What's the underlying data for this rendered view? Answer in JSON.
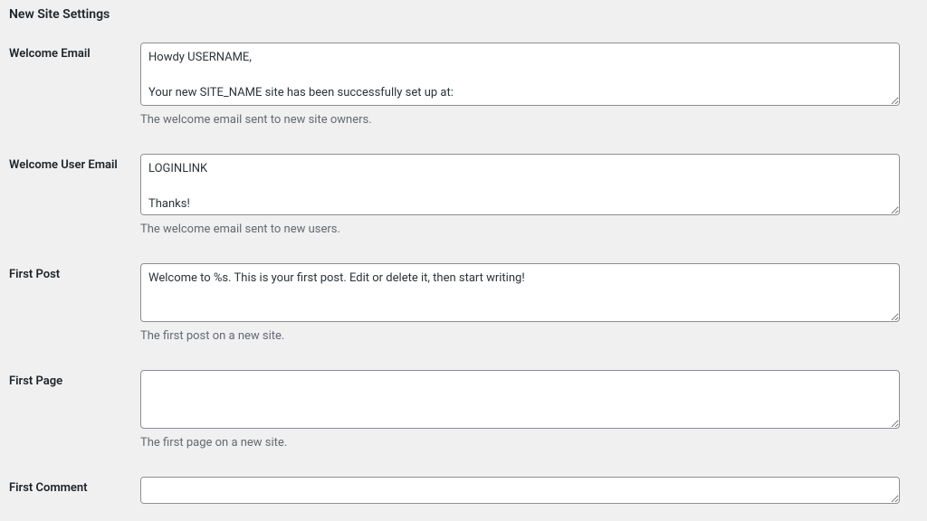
{
  "section": {
    "heading": "New Site Settings"
  },
  "fields": {
    "welcome_email": {
      "label": "Welcome Email",
      "value": "Howdy USERNAME,\n\nYour new SITE_NAME site has been successfully set up at:\nBLOG_URL",
      "description": "The welcome email sent to new site owners."
    },
    "welcome_user_email": {
      "label": "Welcome User Email",
      "value": "LOGINLINK\n\nThanks!\n\n--The Team @ SITE_NAME",
      "description": "The welcome email sent to new users."
    },
    "first_post": {
      "label": "First Post",
      "value": "Welcome to %s. This is your first post. Edit or delete it, then start writing!",
      "description": "The first post on a new site."
    },
    "first_page": {
      "label": "First Page",
      "value": "",
      "description": "The first page on a new site."
    },
    "first_comment": {
      "label": "First Comment",
      "value": "",
      "description": ""
    }
  }
}
